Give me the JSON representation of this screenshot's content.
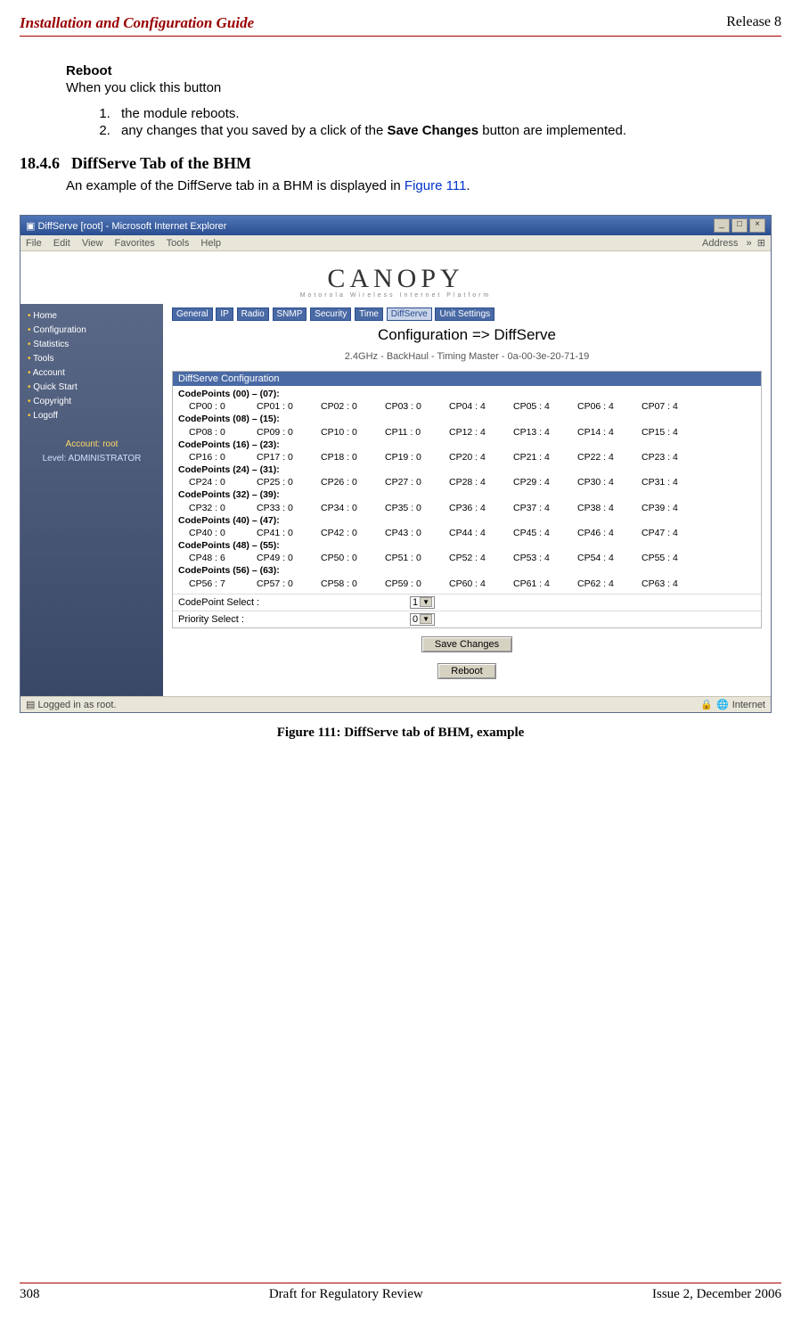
{
  "header": {
    "pub_title": "Installation and Configuration Guide",
    "release": "Release 8"
  },
  "reboot": {
    "heading": "Reboot",
    "lead": "When you click this button",
    "step1": "the module reboots.",
    "step2a": "any changes that you saved by a click of the ",
    "step2bold": "Save Changes",
    "step2b": " button are implemented."
  },
  "section": {
    "num": "18.4.6",
    "title": "DiffServe Tab of the BHM",
    "lead_a": "An example of the DiffServe tab in a BHM is displayed in ",
    "figref": "Figure 111",
    "lead_b": "."
  },
  "screenshot": {
    "window_title": "DiffServe [root] - Microsoft Internet Explorer",
    "menu": {
      "items": [
        "File",
        "Edit",
        "View",
        "Favorites",
        "Tools",
        "Help"
      ],
      "address_label": "Address",
      "chev": "»"
    },
    "logo_main": "CANOPY",
    "logo_sub": "Motorola Wireless Internet Platform",
    "tabs": [
      "General",
      "IP",
      "Radio",
      "SNMP",
      "Security",
      "Time",
      "DiffServe",
      "Unit Settings"
    ],
    "sidebar": {
      "items": [
        "Home",
        "Configuration",
        "Statistics",
        "Tools",
        "Account",
        "Quick Start",
        "Copyright",
        "Logoff"
      ],
      "account": "Account: root",
      "level": "Level: ADMINISTRATOR"
    },
    "cfg_title": "Configuration => DiffServe",
    "cfg_sub": "2.4GHz - BackHaul - Timing Master - 0a-00-3e-20-71-19",
    "panel_head": "DiffServe Configuration",
    "codepoint_groups": [
      {
        "label": "CodePoints (00) – (07):",
        "cells": [
          "CP00 : 0",
          "CP01 : 0",
          "CP02 : 0",
          "CP03 : 0",
          "CP04 : 4",
          "CP05 : 4",
          "CP06 : 4",
          "CP07 : 4"
        ]
      },
      {
        "label": "CodePoints (08) – (15):",
        "cells": [
          "CP08 : 0",
          "CP09 : 0",
          "CP10 : 0",
          "CP11 : 0",
          "CP12 : 4",
          "CP13 : 4",
          "CP14 : 4",
          "CP15 : 4"
        ]
      },
      {
        "label": "CodePoints (16) – (23):",
        "cells": [
          "CP16 : 0",
          "CP17 : 0",
          "CP18 : 0",
          "CP19 : 0",
          "CP20 : 4",
          "CP21 : 4",
          "CP22 : 4",
          "CP23 : 4"
        ]
      },
      {
        "label": "CodePoints (24) – (31):",
        "cells": [
          "CP24 : 0",
          "CP25 : 0",
          "CP26 : 0",
          "CP27 : 0",
          "CP28 : 4",
          "CP29 : 4",
          "CP30 : 4",
          "CP31 : 4"
        ]
      },
      {
        "label": "CodePoints (32) – (39):",
        "cells": [
          "CP32 : 0",
          "CP33 : 0",
          "CP34 : 0",
          "CP35 : 0",
          "CP36 : 4",
          "CP37 : 4",
          "CP38 : 4",
          "CP39 : 4"
        ]
      },
      {
        "label": "CodePoints (40) – (47):",
        "cells": [
          "CP40 : 0",
          "CP41 : 0",
          "CP42 : 0",
          "CP43 : 0",
          "CP44 : 4",
          "CP45 : 4",
          "CP46 : 4",
          "CP47 : 4"
        ]
      },
      {
        "label": "CodePoints (48) – (55):",
        "cells": [
          "CP48 : 6",
          "CP49 : 0",
          "CP50 : 0",
          "CP51 : 0",
          "CP52 : 4",
          "CP53 : 4",
          "CP54 : 4",
          "CP55 : 4"
        ]
      },
      {
        "label": "CodePoints (56) – (63):",
        "cells": [
          "CP56 : 7",
          "CP57 : 0",
          "CP58 : 0",
          "CP59 : 0",
          "CP60 : 4",
          "CP61 : 4",
          "CP62 : 4",
          "CP63 : 4"
        ]
      }
    ],
    "codepoint_select_label": "CodePoint Select :",
    "codepoint_select_value": "1",
    "priority_select_label": "Priority Select :",
    "priority_select_value": "0",
    "save_btn": "Save Changes",
    "reboot_btn": "Reboot",
    "status_left": "Logged in as root.",
    "status_right": "Internet"
  },
  "figcaption": "Figure 111: DiffServe tab of BHM, example",
  "footer": {
    "page": "308",
    "center": "Draft for Regulatory Review",
    "right": "Issue 2, December 2006"
  }
}
